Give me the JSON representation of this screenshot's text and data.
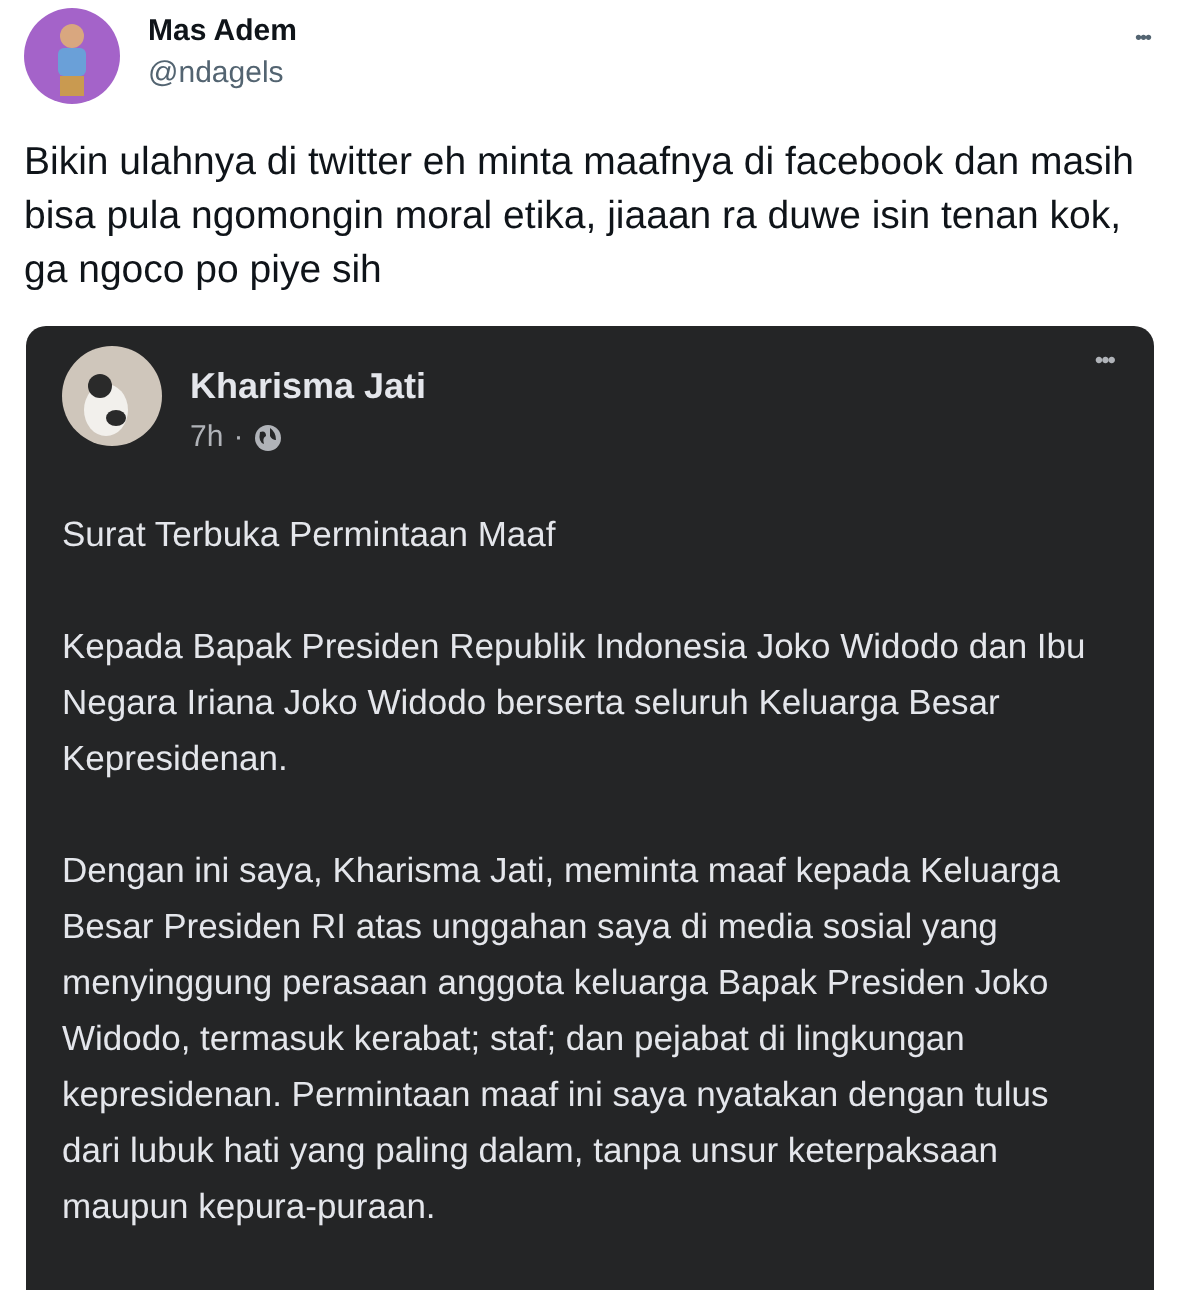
{
  "tweet": {
    "name": "Mas Adem",
    "handle": "@ndagels",
    "more": "•••",
    "text": "Bikin ulahnya di twitter eh minta maafnya di facebook dan masih bisa pula ngomongin moral etika, jiaaan ra duwe isin tenan kok, ga ngoco po piye sih"
  },
  "embedded_post": {
    "name": "Kharisma Jati",
    "time": "7h",
    "separator": "·",
    "more": "•••",
    "paragraphs": [
      "Surat Terbuka Permintaan Maaf",
      "Kepada Bapak Presiden Republik Indonesia Joko Widodo dan Ibu Negara Iriana Joko Widodo berserta seluruh Keluarga Besar Kepresidenan.",
      "Dengan ini saya, Kharisma Jati, meminta maaf kepada Keluarga Besar Presiden RI atas unggahan saya di media sosial yang menyinggung perasaan anggota keluarga Bapak Presiden Joko Widodo, termasuk kerabat; staf; dan pejabat di lingkungan kepresidenan. Permintaan maaf ini saya nyatakan dengan tulus dari lubuk hati yang paling dalam, tanpa unsur keterpaksaan maupun kepura-puraan."
    ]
  }
}
